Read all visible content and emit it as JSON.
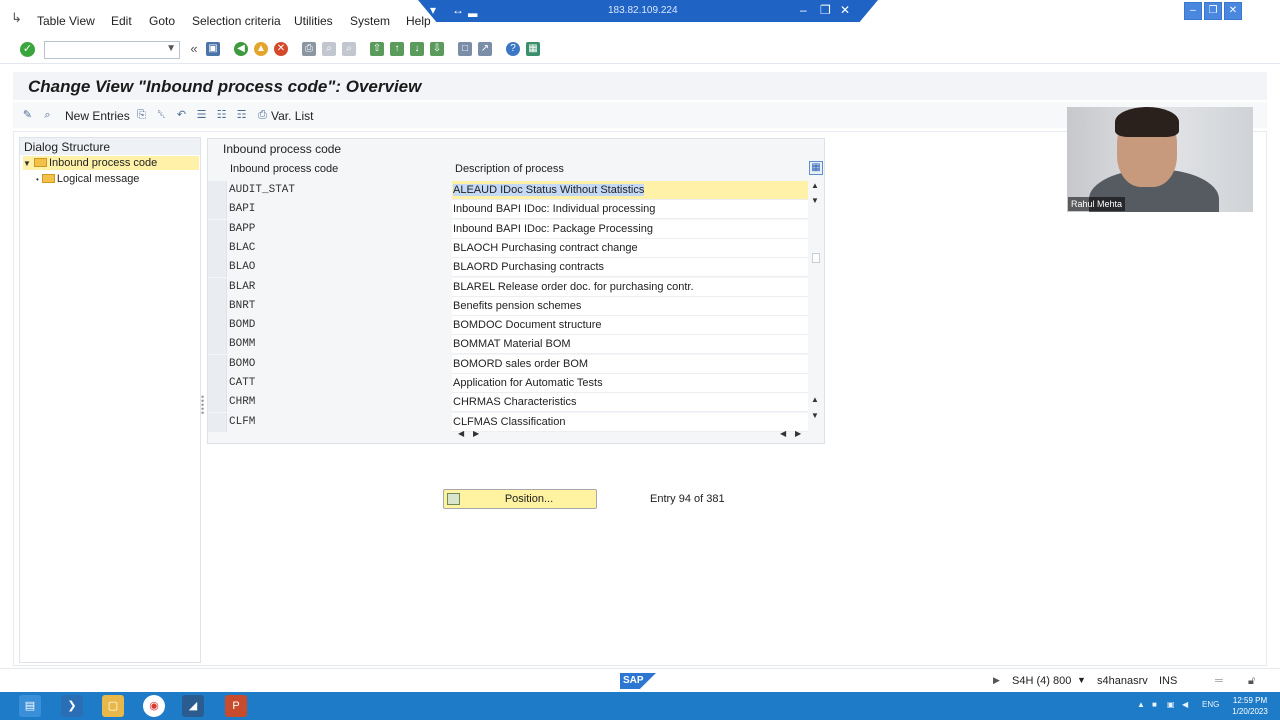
{
  "menu": {
    "items": [
      "Table View",
      "Edit",
      "Goto",
      "Selection criteria",
      "Utilities",
      "System",
      "Help"
    ]
  },
  "remote": {
    "ip": "183.82.109.224"
  },
  "title": "Change View \"Inbound process code\": Overview",
  "app_toolbar": {
    "new_entries": "New Entries",
    "var_list": "Var. List"
  },
  "dialog_structure": {
    "header": "Dialog Structure",
    "items": [
      {
        "label": "Inbound process code",
        "selected": true
      },
      {
        "label": "Logical message",
        "selected": false
      }
    ]
  },
  "table": {
    "title": "Inbound process code",
    "columns": [
      "Inbound process code",
      "Description of process"
    ],
    "rows": [
      {
        "code": "AUDIT_STAT",
        "desc": "ALEAUD  IDoc Status Without Statistics"
      },
      {
        "code": "BAPI",
        "desc": "Inbound BAPI IDoc: Individual processing"
      },
      {
        "code": "BAPP",
        "desc": "Inbound BAPI IDoc: Package Processing"
      },
      {
        "code": "BLAC",
        "desc": "BLAOCH  Purchasing contract change"
      },
      {
        "code": "BLAO",
        "desc": "BLAORD  Purchasing contracts"
      },
      {
        "code": "BLAR",
        "desc": "BLAREL  Release order doc. for purchasing contr."
      },
      {
        "code": "BNRT",
        "desc": "Benefits pension schemes"
      },
      {
        "code": "BOMD",
        "desc": "BOMDOC  Document structure"
      },
      {
        "code": "BOMM",
        "desc": "BOMMAT  Material BOM"
      },
      {
        "code": "BOMO",
        "desc": "BOMORD sales order BOM"
      },
      {
        "code": "CATT",
        "desc": "Application for Automatic Tests"
      },
      {
        "code": "CHRM",
        "desc": "CHRMAS Characteristics"
      },
      {
        "code": "CLFM",
        "desc": "CLFMAS   Classification"
      }
    ]
  },
  "position_button": "Position...",
  "entry_info": "Entry 94 of 381",
  "webcam": {
    "name": "Rahul Mehta"
  },
  "status": {
    "system": "S4H (4) 800",
    "server": "s4hanasrv",
    "mode": "INS"
  },
  "taskbar": {
    "lang": "ENG",
    "time": "12:59 PM",
    "date": "1/20/2023"
  }
}
